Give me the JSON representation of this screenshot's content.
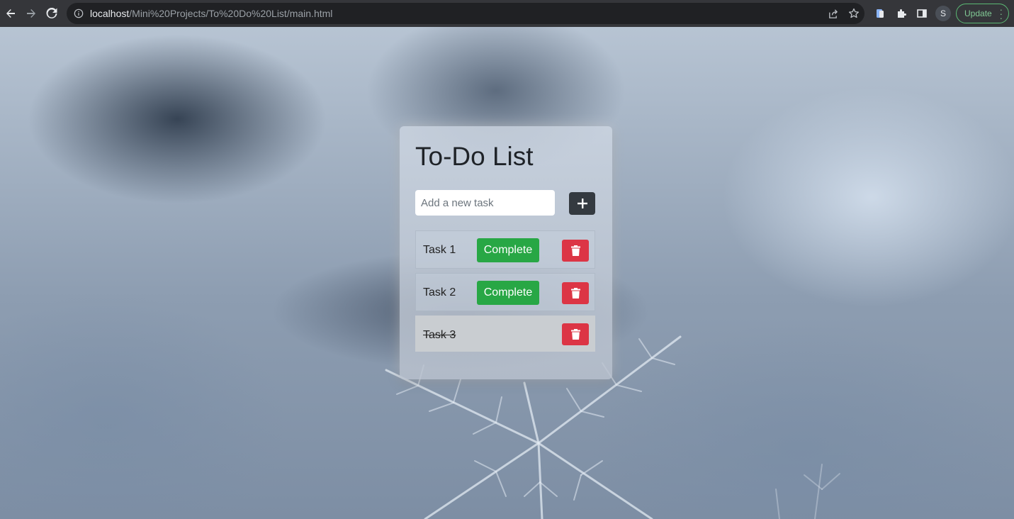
{
  "browser": {
    "url_host": "localhost",
    "url_path": "/Mini%20Projects/To%20Do%20List/main.html",
    "profile_initial": "S",
    "update_label": "Update"
  },
  "app": {
    "title": "To-Do List",
    "input_placeholder": "Add a new task",
    "input_value": "",
    "add_label": "+",
    "tasks": [
      {
        "label": "Task 1",
        "completed": false,
        "complete_label": "Complete"
      },
      {
        "label": "Task 2",
        "completed": false,
        "complete_label": "Complete"
      },
      {
        "label": "Task 3",
        "completed": true
      }
    ]
  },
  "colors": {
    "complete_button": "#28a745",
    "delete_button": "#dc3545",
    "add_button": "#343a40"
  },
  "icons": [
    "back-arrow-icon",
    "forward-arrow-icon",
    "reload-icon",
    "info-icon",
    "share-icon",
    "star-icon",
    "extension-icon",
    "puzzle-icon",
    "sidebar-icon",
    "kebab-menu-icon",
    "plus-icon",
    "trash-icon"
  ]
}
